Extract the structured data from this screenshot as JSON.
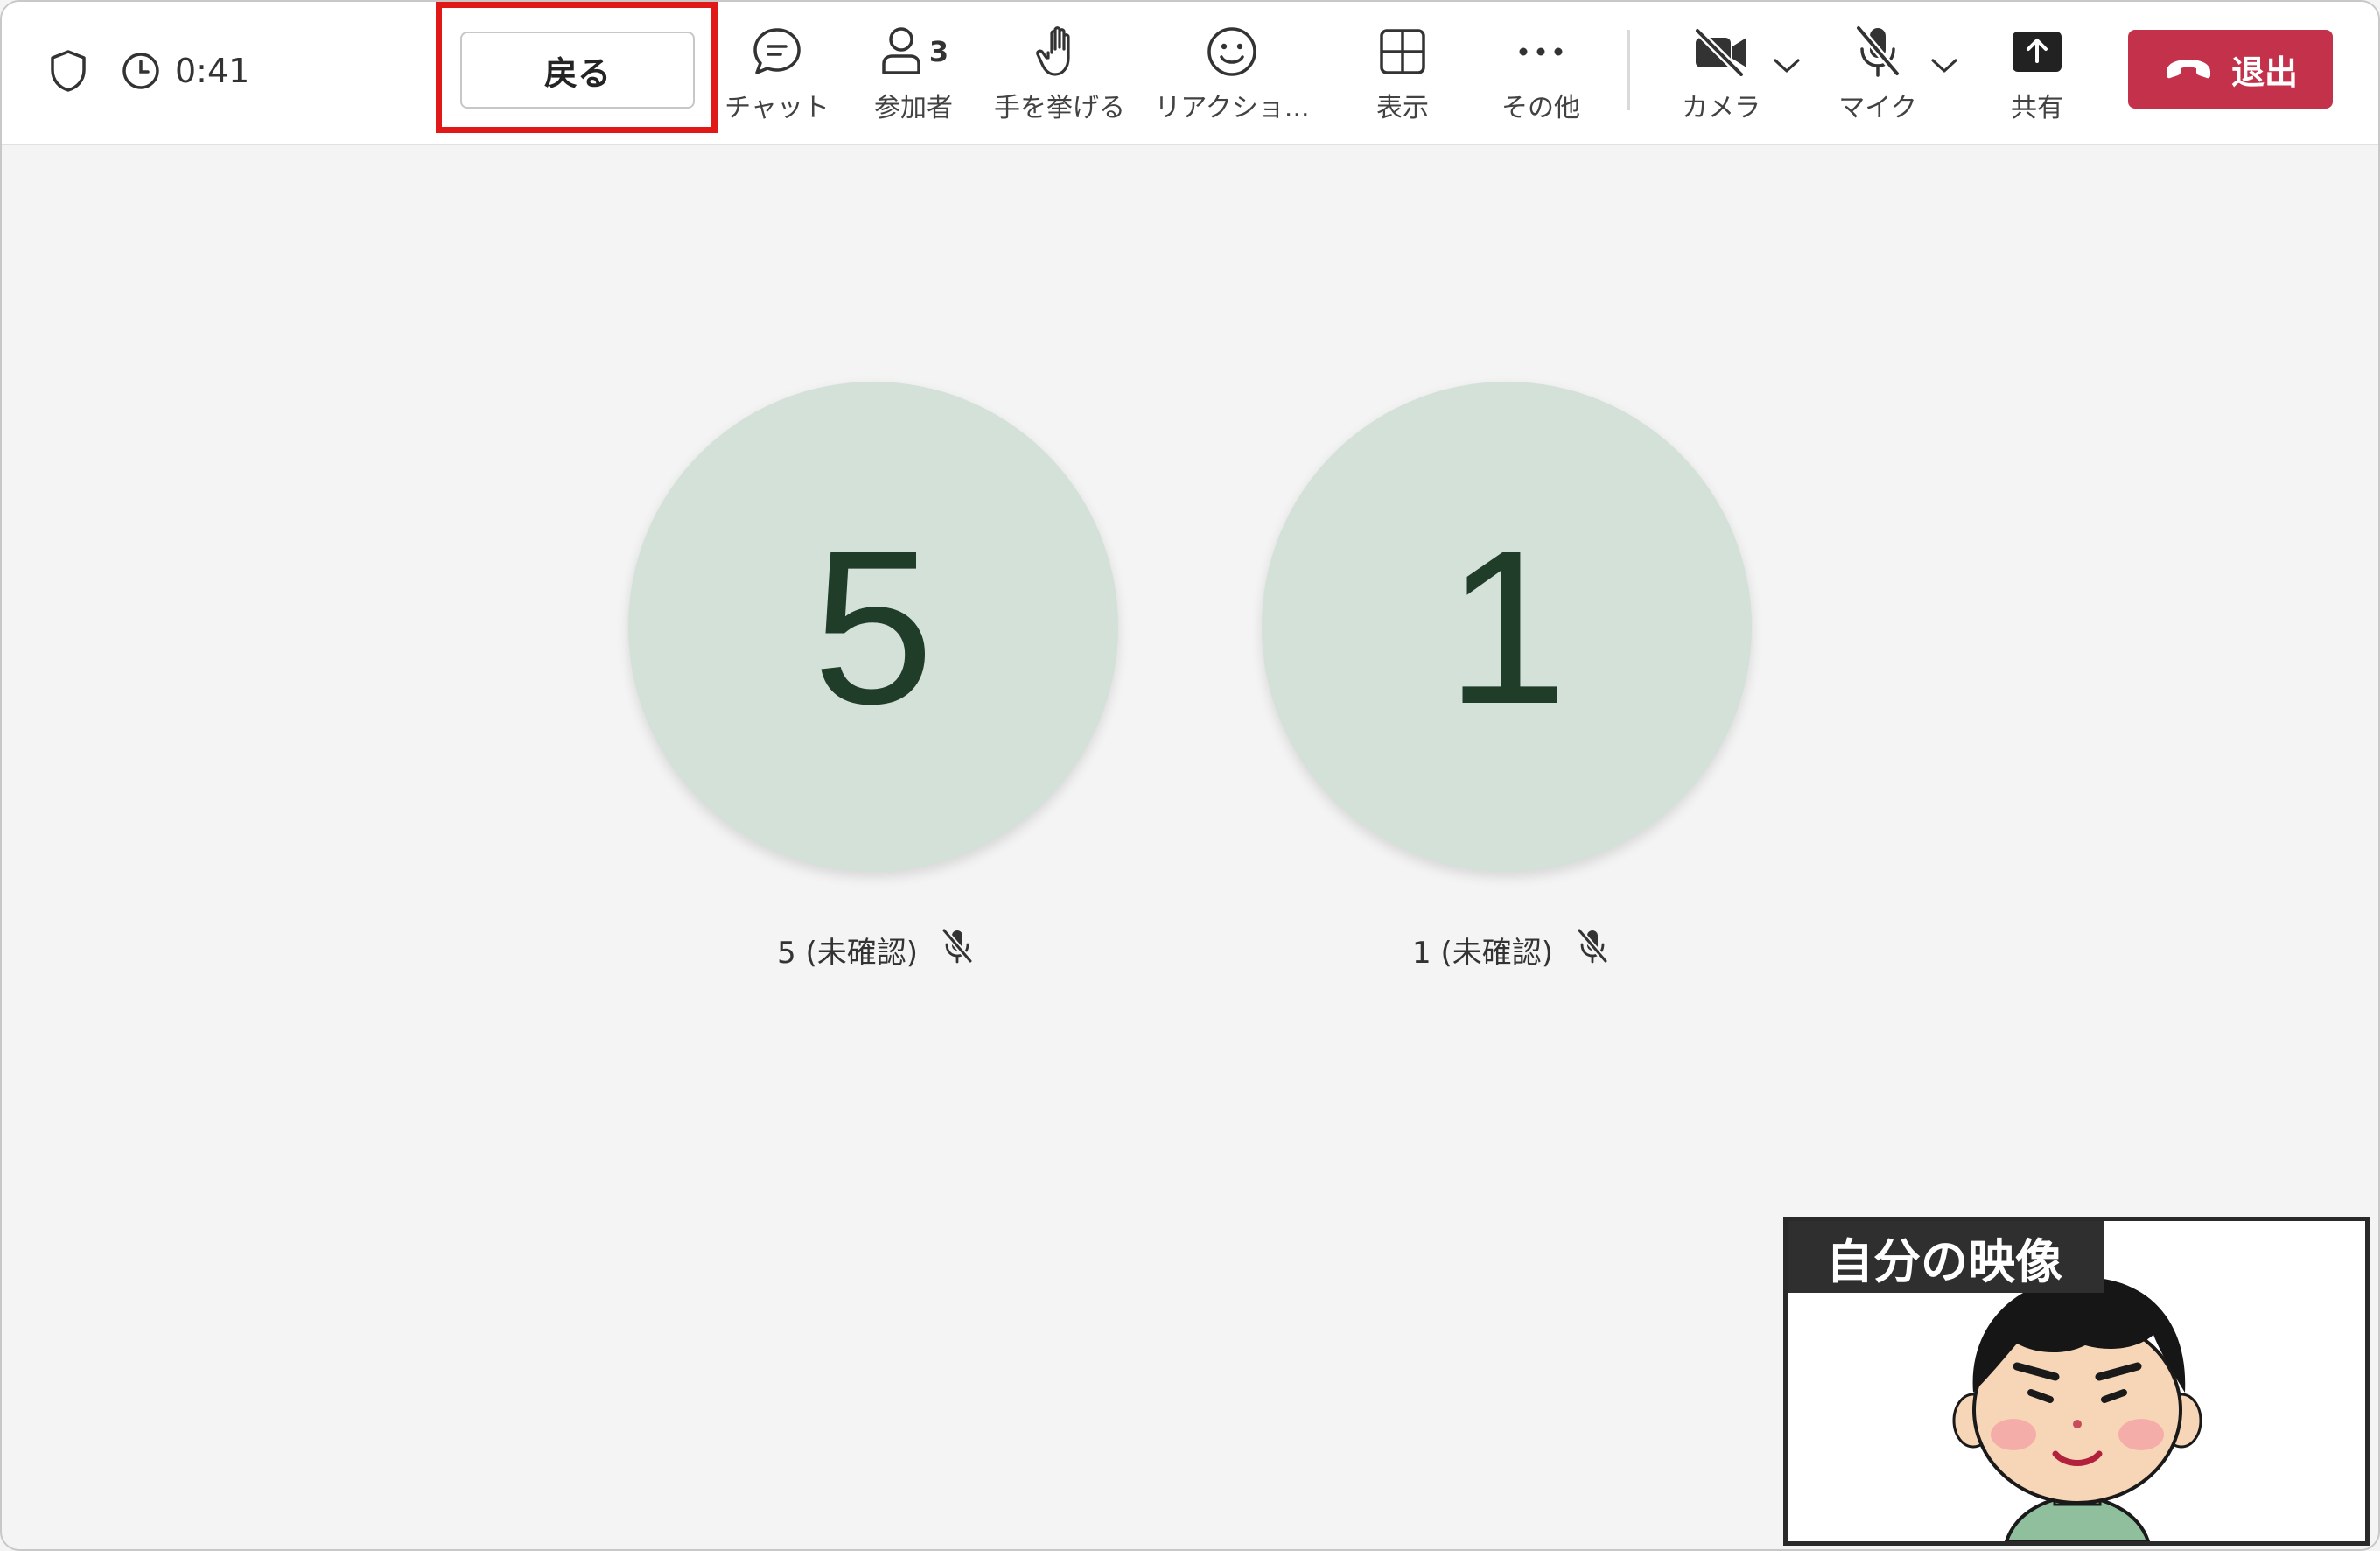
{
  "header": {
    "timer": "0:41",
    "back_label": "戻る",
    "tools": {
      "chat": "チャット",
      "participants": "参加者",
      "participants_count": "3",
      "raise_hand": "手を挙げる",
      "reactions": "リアクショ...",
      "view": "表示",
      "more": "その他",
      "camera": "カメラ",
      "mic": "マイク",
      "share": "共有"
    },
    "leave_label": "退出"
  },
  "participants": [
    {
      "initial": "5",
      "name": "5 (未確認)"
    },
    {
      "initial": "1",
      "name": "1 (未確認)"
    }
  ],
  "self_view": {
    "label": "自分の映像"
  },
  "colors": {
    "leave": "#c4314b",
    "highlight": "#e11818",
    "avatar_bg": "#d3e1d8",
    "avatar_text": "#203d2a"
  },
  "icons": [
    "shield-icon",
    "clock-icon",
    "chat-icon",
    "people-icon",
    "hand-icon",
    "emoji-icon",
    "grid-icon",
    "more-icon",
    "camera-off-icon",
    "mic-off-icon",
    "share-icon",
    "hangup-icon",
    "chevron-down-icon"
  ]
}
